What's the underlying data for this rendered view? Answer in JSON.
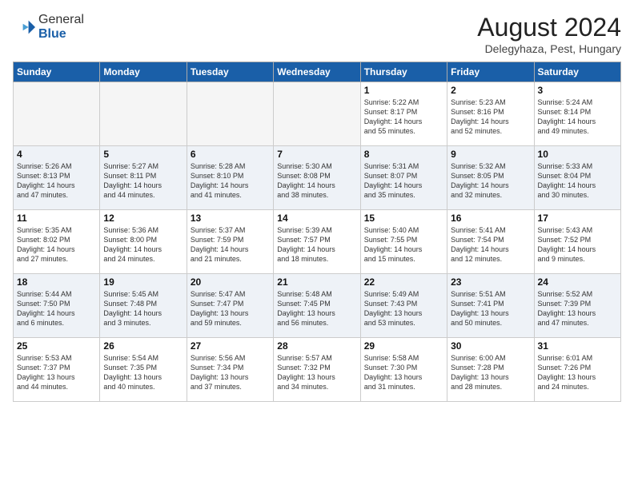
{
  "header": {
    "logo": {
      "general": "General",
      "blue": "Blue"
    },
    "title": "August 2024",
    "location": "Delegyhaza, Pest, Hungary"
  },
  "calendar": {
    "days_of_week": [
      "Sunday",
      "Monday",
      "Tuesday",
      "Wednesday",
      "Thursday",
      "Friday",
      "Saturday"
    ],
    "rows": [
      [
        {
          "day": "",
          "empty": true
        },
        {
          "day": "",
          "empty": true
        },
        {
          "day": "",
          "empty": true
        },
        {
          "day": "",
          "empty": true
        },
        {
          "day": "1",
          "line1": "Sunrise: 5:22 AM",
          "line2": "Sunset: 8:17 PM",
          "line3": "Daylight: 14 hours",
          "line4": "and 55 minutes."
        },
        {
          "day": "2",
          "line1": "Sunrise: 5:23 AM",
          "line2": "Sunset: 8:16 PM",
          "line3": "Daylight: 14 hours",
          "line4": "and 52 minutes."
        },
        {
          "day": "3",
          "line1": "Sunrise: 5:24 AM",
          "line2": "Sunset: 8:14 PM",
          "line3": "Daylight: 14 hours",
          "line4": "and 49 minutes."
        }
      ],
      [
        {
          "day": "4",
          "line1": "Sunrise: 5:26 AM",
          "line2": "Sunset: 8:13 PM",
          "line3": "Daylight: 14 hours",
          "line4": "and 47 minutes."
        },
        {
          "day": "5",
          "line1": "Sunrise: 5:27 AM",
          "line2": "Sunset: 8:11 PM",
          "line3": "Daylight: 14 hours",
          "line4": "and 44 minutes."
        },
        {
          "day": "6",
          "line1": "Sunrise: 5:28 AM",
          "line2": "Sunset: 8:10 PM",
          "line3": "Daylight: 14 hours",
          "line4": "and 41 minutes."
        },
        {
          "day": "7",
          "line1": "Sunrise: 5:30 AM",
          "line2": "Sunset: 8:08 PM",
          "line3": "Daylight: 14 hours",
          "line4": "and 38 minutes."
        },
        {
          "day": "8",
          "line1": "Sunrise: 5:31 AM",
          "line2": "Sunset: 8:07 PM",
          "line3": "Daylight: 14 hours",
          "line4": "and 35 minutes."
        },
        {
          "day": "9",
          "line1": "Sunrise: 5:32 AM",
          "line2": "Sunset: 8:05 PM",
          "line3": "Daylight: 14 hours",
          "line4": "and 32 minutes."
        },
        {
          "day": "10",
          "line1": "Sunrise: 5:33 AM",
          "line2": "Sunset: 8:04 PM",
          "line3": "Daylight: 14 hours",
          "line4": "and 30 minutes."
        }
      ],
      [
        {
          "day": "11",
          "line1": "Sunrise: 5:35 AM",
          "line2": "Sunset: 8:02 PM",
          "line3": "Daylight: 14 hours",
          "line4": "and 27 minutes."
        },
        {
          "day": "12",
          "line1": "Sunrise: 5:36 AM",
          "line2": "Sunset: 8:00 PM",
          "line3": "Daylight: 14 hours",
          "line4": "and 24 minutes."
        },
        {
          "day": "13",
          "line1": "Sunrise: 5:37 AM",
          "line2": "Sunset: 7:59 PM",
          "line3": "Daylight: 14 hours",
          "line4": "and 21 minutes."
        },
        {
          "day": "14",
          "line1": "Sunrise: 5:39 AM",
          "line2": "Sunset: 7:57 PM",
          "line3": "Daylight: 14 hours",
          "line4": "and 18 minutes."
        },
        {
          "day": "15",
          "line1": "Sunrise: 5:40 AM",
          "line2": "Sunset: 7:55 PM",
          "line3": "Daylight: 14 hours",
          "line4": "and 15 minutes."
        },
        {
          "day": "16",
          "line1": "Sunrise: 5:41 AM",
          "line2": "Sunset: 7:54 PM",
          "line3": "Daylight: 14 hours",
          "line4": "and 12 minutes."
        },
        {
          "day": "17",
          "line1": "Sunrise: 5:43 AM",
          "line2": "Sunset: 7:52 PM",
          "line3": "Daylight: 14 hours",
          "line4": "and 9 minutes."
        }
      ],
      [
        {
          "day": "18",
          "line1": "Sunrise: 5:44 AM",
          "line2": "Sunset: 7:50 PM",
          "line3": "Daylight: 14 hours",
          "line4": "and 6 minutes."
        },
        {
          "day": "19",
          "line1": "Sunrise: 5:45 AM",
          "line2": "Sunset: 7:48 PM",
          "line3": "Daylight: 14 hours",
          "line4": "and 3 minutes."
        },
        {
          "day": "20",
          "line1": "Sunrise: 5:47 AM",
          "line2": "Sunset: 7:47 PM",
          "line3": "Daylight: 13 hours",
          "line4": "and 59 minutes."
        },
        {
          "day": "21",
          "line1": "Sunrise: 5:48 AM",
          "line2": "Sunset: 7:45 PM",
          "line3": "Daylight: 13 hours",
          "line4": "and 56 minutes."
        },
        {
          "day": "22",
          "line1": "Sunrise: 5:49 AM",
          "line2": "Sunset: 7:43 PM",
          "line3": "Daylight: 13 hours",
          "line4": "and 53 minutes."
        },
        {
          "day": "23",
          "line1": "Sunrise: 5:51 AM",
          "line2": "Sunset: 7:41 PM",
          "line3": "Daylight: 13 hours",
          "line4": "and 50 minutes."
        },
        {
          "day": "24",
          "line1": "Sunrise: 5:52 AM",
          "line2": "Sunset: 7:39 PM",
          "line3": "Daylight: 13 hours",
          "line4": "and 47 minutes."
        }
      ],
      [
        {
          "day": "25",
          "line1": "Sunrise: 5:53 AM",
          "line2": "Sunset: 7:37 PM",
          "line3": "Daylight: 13 hours",
          "line4": "and 44 minutes."
        },
        {
          "day": "26",
          "line1": "Sunrise: 5:54 AM",
          "line2": "Sunset: 7:35 PM",
          "line3": "Daylight: 13 hours",
          "line4": "and 40 minutes."
        },
        {
          "day": "27",
          "line1": "Sunrise: 5:56 AM",
          "line2": "Sunset: 7:34 PM",
          "line3": "Daylight: 13 hours",
          "line4": "and 37 minutes."
        },
        {
          "day": "28",
          "line1": "Sunrise: 5:57 AM",
          "line2": "Sunset: 7:32 PM",
          "line3": "Daylight: 13 hours",
          "line4": "and 34 minutes."
        },
        {
          "day": "29",
          "line1": "Sunrise: 5:58 AM",
          "line2": "Sunset: 7:30 PM",
          "line3": "Daylight: 13 hours",
          "line4": "and 31 minutes."
        },
        {
          "day": "30",
          "line1": "Sunrise: 6:00 AM",
          "line2": "Sunset: 7:28 PM",
          "line3": "Daylight: 13 hours",
          "line4": "and 28 minutes."
        },
        {
          "day": "31",
          "line1": "Sunrise: 6:01 AM",
          "line2": "Sunset: 7:26 PM",
          "line3": "Daylight: 13 hours",
          "line4": "and 24 minutes."
        }
      ]
    ]
  }
}
